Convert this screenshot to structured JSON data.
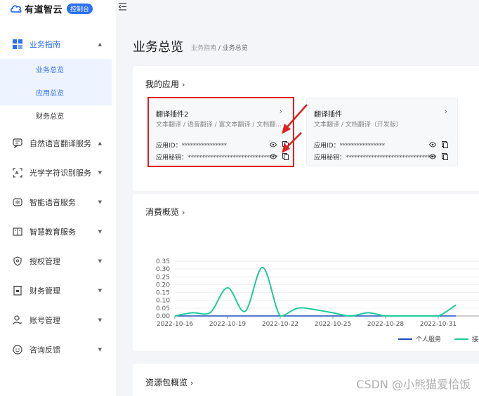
{
  "brand": {
    "name": "有道智云",
    "badge": "控制台"
  },
  "sidebar": {
    "items": [
      {
        "label": "业务指南",
        "icon": "grid-icon",
        "expanded": true,
        "active": true,
        "children": [
          {
            "label": "业务总览",
            "selected": true
          },
          {
            "label": "应用总览",
            "selected": true
          },
          {
            "label": "财务总览",
            "selected": false
          }
        ]
      },
      {
        "label": "自然语言翻译服务",
        "icon": "chat-translate-icon",
        "expanded": true
      },
      {
        "label": "光学字符识别服务",
        "icon": "scan-icon",
        "expanded": false
      },
      {
        "label": "智能语音服务",
        "icon": "voice-icon",
        "expanded": false
      },
      {
        "label": "智慧教育服务",
        "icon": "book-icon",
        "expanded": false
      },
      {
        "label": "授权管理",
        "icon": "shield-icon",
        "expanded": false
      },
      {
        "label": "财务管理",
        "icon": "finance-icon",
        "expanded": false
      },
      {
        "label": "账号管理",
        "icon": "user-icon",
        "expanded": false
      },
      {
        "label": "咨询反馈",
        "icon": "feedback-icon",
        "expanded": false
      }
    ]
  },
  "header": {
    "title": "业务总览",
    "breadcrumb": {
      "parent": "业务指南",
      "separator": " / ",
      "current": "业务总览"
    }
  },
  "my_apps": {
    "title": "我的应用",
    "apps": [
      {
        "name": "翻译插件2",
        "desc": "文本翻译 / 语音翻译 / 富文本翻译 / 文档翻...",
        "id_label": "应用ID：",
        "id_value": "****************",
        "key_label": "应用秘钥：",
        "key_value": "********************************"
      },
      {
        "name": "翻译插件",
        "desc": "文本翻译 / 文档翻译（开发版）",
        "id_label": "应用ID：",
        "id_value": "****************",
        "key_label": "应用秘钥：",
        "key_value": "********************************"
      }
    ]
  },
  "consumption": {
    "title": "消费概览"
  },
  "chart_data": {
    "type": "line",
    "x": [
      "2022-10-16",
      "2022-10-17",
      "2022-10-18",
      "2022-10-19",
      "2022-10-20",
      "2022-10-21",
      "2022-10-22",
      "2022-10-23",
      "2022-10-24",
      "2022-10-25",
      "2022-10-26",
      "2022-10-27",
      "2022-10-28",
      "2022-10-29",
      "2022-10-30",
      "2022-10-31",
      "2022-11-01"
    ],
    "xticks": [
      "2022-10-16",
      "2022-10-19",
      "2022-10-22",
      "2022-10-25",
      "2022-10-28",
      "2022-10-31"
    ],
    "yticks": [
      "0.00",
      "0.05",
      "0.10",
      "0.15",
      "0.20",
      "0.25",
      "0.30",
      "0.35"
    ],
    "ylim": [
      0,
      0.35
    ],
    "series": [
      {
        "name": "个人服务",
        "color": "#1f4fbf",
        "values": [
          0,
          0,
          0,
          0,
          0,
          0,
          0,
          0,
          0,
          0,
          0,
          0,
          0,
          0,
          0,
          0,
          0
        ]
      },
      {
        "name": "接口服务",
        "color": "#1ecb9b",
        "values": [
          0,
          0.02,
          0.02,
          0.18,
          0.03,
          0.31,
          0,
          0.05,
          0.04,
          0.02,
          0,
          0.02,
          0,
          0,
          0,
          0,
          0.07
        ]
      }
    ],
    "legend": "bottom-right",
    "grid": true
  },
  "resource": {
    "title": "资源包概览"
  },
  "watermark": "CSDN @小熊猫爱恰饭",
  "colors": {
    "accent": "#2b6ff2",
    "highlight": "#e02020"
  }
}
